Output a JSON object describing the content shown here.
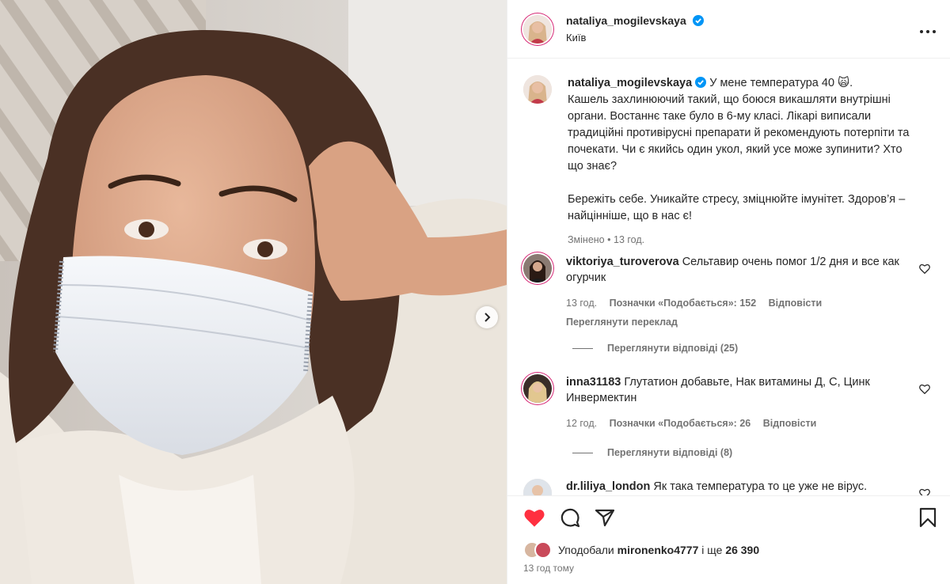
{
  "post": {
    "author": "nataliya_mogilevskaya",
    "location": "Київ",
    "caption_author": "nataliya_mogilevskaya",
    "caption": "У мене температура 40 🙀.\nКашель захлинюючий такий, що боюся викашляти внутрішні органи. Востаннє таке було в 6-му класі. Лікарі виписали традиційні противірусні препарати й рекомендують потерпіти та почекати. Чи є якийсь один укол, який усе може зупинити? Хто що знає?\n\nБережіть себе. Уникайте стресу, зміцнюйте імунітет. Здоров’я – найцінніше, що в нас є!",
    "edited": "Змінено",
    "edited_sep": "•",
    "edited_time": "13 год."
  },
  "comments": [
    {
      "user": "viktoriya_turoverova",
      "text": "Сельтавир очень помог 1/2 дня и все как огурчик",
      "time": "13 год.",
      "likes": "Позначки «Подобається»: 152",
      "reply": "Відповісти",
      "translate": "Переглянути переклад",
      "view_replies": "Переглянути відповіді (25)"
    },
    {
      "user": "inna31183",
      "text": "Глутатион добавьте, Нак витамины Д, С, Цинк Инвермектин",
      "time": "12 год.",
      "likes": "Позначки «Подобається»: 26",
      "reply": "Відповісти",
      "view_replies": "Переглянути відповіді (8)"
    },
    {
      "user": "dr.liliya_london",
      "text": "Як така температура то це уже не вірус."
    }
  ],
  "footer": {
    "liked_prefix": "Уподобали",
    "liked_user": "mironenko4777",
    "liked_mid": "і ще",
    "liked_count": "26 390",
    "time_ago": "13 год тому"
  },
  "colors": {
    "heart": "#ff3040",
    "verified": "#0095f6",
    "muted": "#737373"
  },
  "icons": [
    "verified-badge-icon",
    "more-icon",
    "heart-icon",
    "comment-icon",
    "share-icon",
    "bookmark-icon",
    "chevron-right-icon"
  ]
}
